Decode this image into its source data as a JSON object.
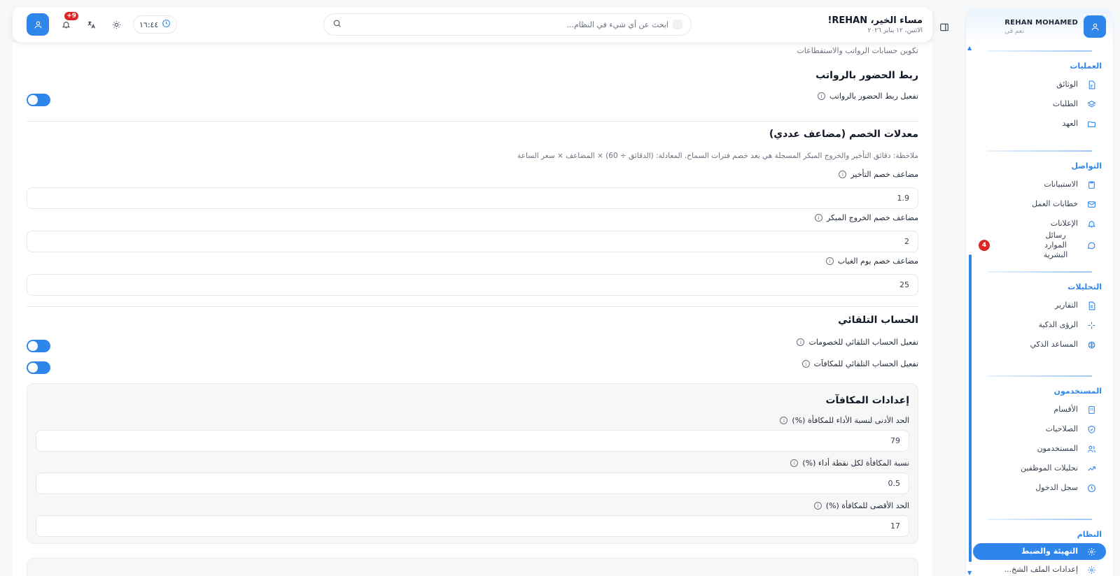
{
  "sidebar": {
    "user_name": "REHAN MOHAMED",
    "user_sub": "نعم قي",
    "sections": [
      {
        "title": "العمليات",
        "items": [
          {
            "label": "الوثائق",
            "icon": "document-icon"
          },
          {
            "label": "الطلبات",
            "icon": "layers-icon"
          },
          {
            "label": "العهد",
            "icon": "folder-icon"
          }
        ]
      },
      {
        "title": "التواصل",
        "items": [
          {
            "label": "الاستبيانات",
            "icon": "clipboard-icon"
          },
          {
            "label": "خطابات العمل",
            "icon": "mail-icon"
          },
          {
            "label": "الإعلانات",
            "icon": "bell-icon"
          },
          {
            "label": "رسائل الموارد البشرية",
            "icon": "chat-icon",
            "badge": "4"
          }
        ]
      },
      {
        "title": "التحليلات",
        "items": [
          {
            "label": "التقارير",
            "icon": "report-icon"
          },
          {
            "label": "الرؤى الذكية",
            "icon": "sparkle-icon"
          },
          {
            "label": "المساعد الذكي",
            "icon": "brain-icon"
          }
        ]
      },
      {
        "title": "المستخدمون",
        "items": [
          {
            "label": "الأقسام",
            "icon": "building-icon"
          },
          {
            "label": "الصلاحيات",
            "icon": "shield-icon"
          },
          {
            "label": "المستخدمون",
            "icon": "users-icon"
          },
          {
            "label": "تحليلات الموظفين",
            "icon": "trend-icon"
          },
          {
            "label": "سجل الدخول",
            "icon": "clock-icon"
          }
        ]
      },
      {
        "title": "النظام",
        "items": [
          {
            "label": "التهيئة والضبط",
            "icon": "gear-icon",
            "active": true
          },
          {
            "label": "إعدادات الملف الشخ...",
            "icon": "gear-icon"
          }
        ]
      }
    ]
  },
  "header": {
    "greeting": "مساء الخير، REHAN!",
    "date": "الاثنين، ١٢ يناير ٢٠٢٦",
    "search_placeholder": "ابحث عن أي شيء في النظام...",
    "time": "١٦:٤٤",
    "notifications_badge": "+9"
  },
  "main": {
    "caption": "تكوين حسابات الرواتب والاستقطاعات",
    "attendance": {
      "title": "ربط الحضور بالرواتب",
      "toggle_label": "تفعيل ربط الحضور بالرواتب",
      "enabled": true
    },
    "deductions": {
      "title": "معدلات الخصم (مضاعف عددي)",
      "note": "ملاحظة: دقائق التأخير والخروج المبكر المسجلة هي بعد خصم فترات السماح. المعادلة: (الدقائق ÷ 60) × المضاعف × سعر الساعة",
      "late_label": "مضاعف خصم التأخير",
      "late_value": "1.9",
      "early_label": "مضاعف خصم الخروج المبكر",
      "early_value": "2",
      "absence_label": "مضاعف خصم يوم الغياب",
      "absence_value": "25"
    },
    "auto": {
      "title": "الحساب التلقائي",
      "deductions_label": "تفعيل الحساب التلقائي للخصومات",
      "deductions_enabled": true,
      "bonuses_label": "تفعيل الحساب التلقائي للمكافآت",
      "bonuses_enabled": true
    },
    "bonus": {
      "title": "إعدادات المكافآت",
      "min_label": "الحد الأدنى لنسبة الأداء للمكافأة (%)",
      "min_value": "79",
      "per_point_label": "نسبة المكافأة لكل نقطة أداء (%)",
      "per_point_value": "0.5",
      "max_label": "الحد الأقصى للمكافأة (%)",
      "max_value": "17"
    }
  }
}
